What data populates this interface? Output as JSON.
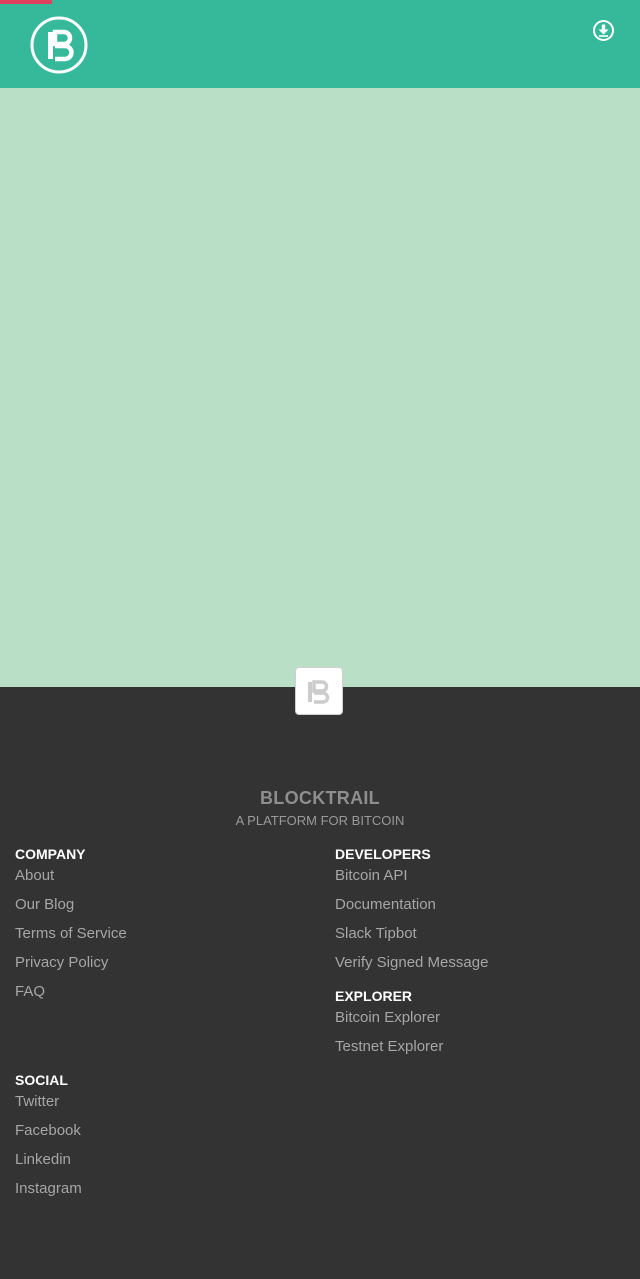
{
  "brand": {
    "name": "BLOCKTRAIL",
    "tagline": "A PLATFORM FOR BITCOIN"
  },
  "colors": {
    "header": "#36b99b",
    "hero": "#b9e0c7",
    "footer": "#333333",
    "accent": "#e0405e"
  },
  "icons": {
    "logo": "blocktrail-logo-icon",
    "download": "download-icon"
  },
  "footer": {
    "company": {
      "heading": "COMPANY",
      "links": [
        "About",
        "Our Blog",
        "Terms of Service",
        "Privacy Policy",
        "FAQ"
      ]
    },
    "developers": {
      "heading": "DEVELOPERS",
      "links": [
        "Bitcoin API",
        "Documentation",
        "Slack Tipbot",
        "Verify Signed Message"
      ]
    },
    "explorer": {
      "heading": "EXPLORER",
      "links": [
        "Bitcoin Explorer",
        "Testnet Explorer"
      ]
    },
    "social": {
      "heading": "SOCIAL",
      "links": [
        "Twitter",
        "Facebook",
        "Linkedin",
        "Instagram"
      ]
    }
  }
}
